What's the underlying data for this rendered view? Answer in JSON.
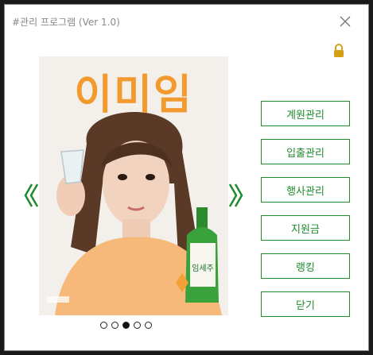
{
  "window": {
    "title": "#관리 프로그램 (Ver 1.0)"
  },
  "poster": {
    "headline": "이미임",
    "bottle_label": "임세주"
  },
  "menu": [
    {
      "label": "계원관리"
    },
    {
      "label": "입출관리"
    },
    {
      "label": "행사관리"
    },
    {
      "label": "지원금"
    },
    {
      "label": "랭킹"
    },
    {
      "label": "닫기"
    }
  ],
  "carousel": {
    "slide_count": 5,
    "active_index": 2
  },
  "colors": {
    "accent": "#1f8b2e",
    "lock": "#d4a017",
    "headline": "#f29a2e"
  },
  "icons": {
    "close": "close-icon",
    "lock": "lock-icon",
    "prev": "chevron-left-icon",
    "next": "chevron-right-icon"
  }
}
